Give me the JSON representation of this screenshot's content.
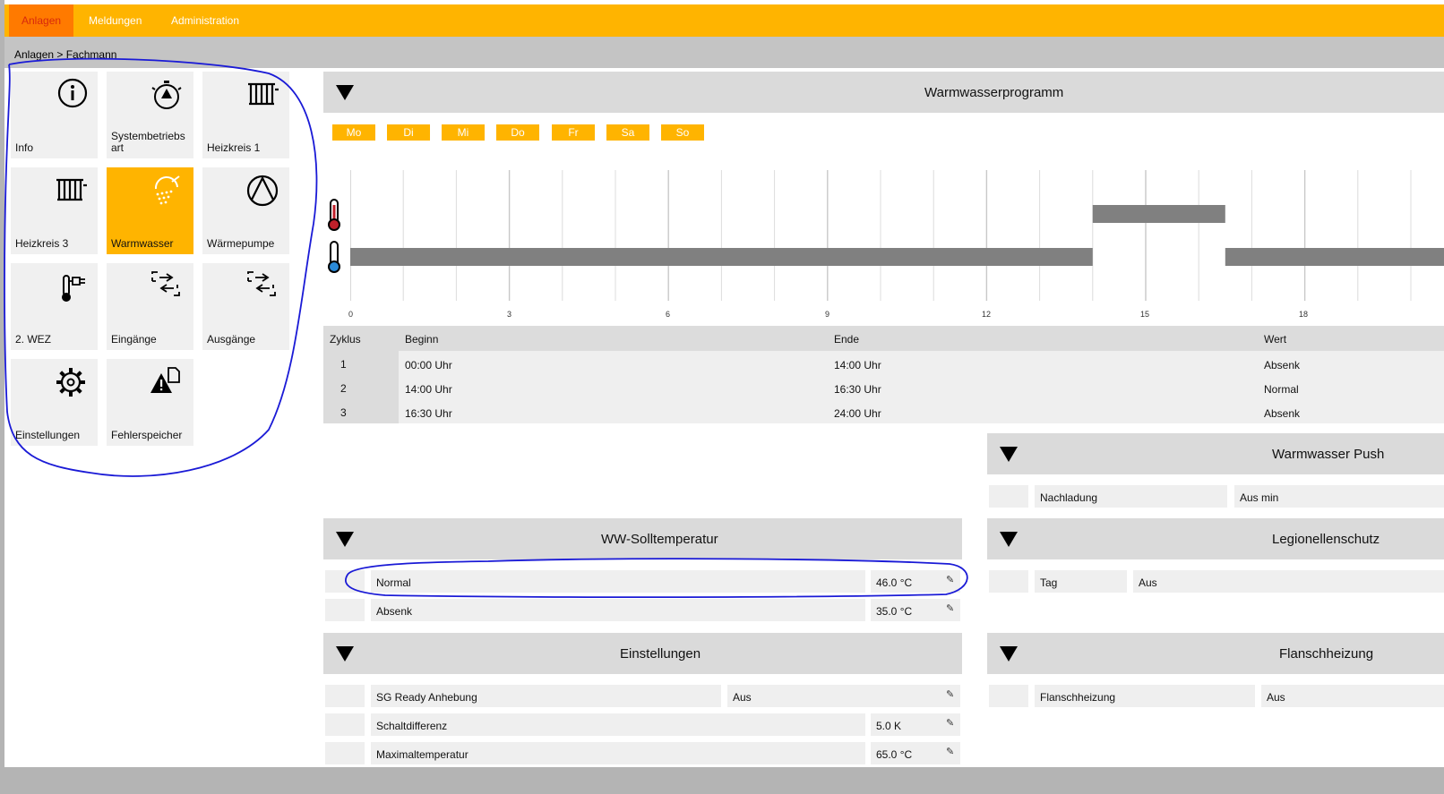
{
  "nav": {
    "tabs": [
      {
        "label": "Anlagen"
      },
      {
        "label": "Meldungen"
      },
      {
        "label": "Administration"
      }
    ]
  },
  "breadcrumb": "Anlagen > Fachmann",
  "tiles": [
    {
      "label": "Info",
      "icon": "info-icon"
    },
    {
      "label": "Systembetriebs art",
      "icon": "timer-icon"
    },
    {
      "label": "Heizkreis 1",
      "icon": "radiator-icon"
    },
    {
      "label": "Heizkreis 3",
      "icon": "radiator-icon"
    },
    {
      "label": "Warmwasser",
      "icon": "shower-icon"
    },
    {
      "label": "Wärmepumpe",
      "icon": "compressor-icon"
    },
    {
      "label": "2. WEZ",
      "icon": "thermometer-plug-icon"
    },
    {
      "label": "Eingänge",
      "icon": "inputs-icon"
    },
    {
      "label": "Ausgänge",
      "icon": "outputs-icon"
    },
    {
      "label": "Einstellungen",
      "icon": "gear-icon"
    },
    {
      "label": "Fehlerspeicher",
      "icon": "warning-file-icon"
    }
  ],
  "program": {
    "title": "Warmwasserprogramm",
    "days": [
      "Mo",
      "Di",
      "Mi",
      "Do",
      "Fr",
      "Sa",
      "So"
    ],
    "ticks": [
      "0",
      "3",
      "6",
      "9",
      "12",
      "15",
      "18"
    ],
    "table": {
      "headers": {
        "zyklus": "Zyklus",
        "beginn": "Beginn",
        "ende": "Ende",
        "wert": "Wert"
      },
      "rows": [
        {
          "zyklus": "1",
          "beginn": "00:00 Uhr",
          "ende": "14:00 Uhr",
          "wert": "Absenk"
        },
        {
          "zyklus": "2",
          "beginn": "14:00 Uhr",
          "ende": "16:30 Uhr",
          "wert": "Normal"
        },
        {
          "zyklus": "3",
          "beginn": "16:30 Uhr",
          "ende": "24:00 Uhr",
          "wert": "Absenk"
        }
      ]
    }
  },
  "chart_data": {
    "type": "bar",
    "x_range": [
      0,
      24
    ],
    "x_ticks": [
      0,
      3,
      6,
      9,
      12,
      15,
      18
    ],
    "levels": [
      "Normal",
      "Absenk"
    ],
    "segments": [
      {
        "start": 0,
        "end": 14,
        "level": "Absenk"
      },
      {
        "start": 14,
        "end": 16.5,
        "level": "Normal"
      },
      {
        "start": 16.5,
        "end": 24,
        "level": "Absenk"
      }
    ],
    "grid": true
  },
  "ww_soll": {
    "title": "WW-Solltemperatur",
    "rows": [
      {
        "label": "Normal",
        "value": "46.0 °C"
      },
      {
        "label": "Absenk",
        "value": "35.0 °C"
      }
    ]
  },
  "einstellungen": {
    "title": "Einstellungen",
    "rows": [
      {
        "label": "SG Ready Anhebung",
        "value": "Aus"
      },
      {
        "label": "Schaltdifferenz",
        "value": "5.0 K"
      },
      {
        "label": "Maximaltemperatur",
        "value": "65.0 °C"
      }
    ]
  },
  "push": {
    "title": "Warmwasser Push",
    "rows": [
      {
        "label": "Nachladung",
        "value": "Aus min"
      }
    ]
  },
  "legionellen": {
    "title": "Legionellenschutz",
    "rows": [
      {
        "label": "Tag",
        "value": "Aus"
      }
    ]
  },
  "flansch": {
    "title": "Flanschheizung",
    "rows": [
      {
        "label": "Flanschheizung",
        "value": "Aus"
      }
    ]
  },
  "colors": {
    "accent": "#ffb400",
    "active_tab": "#ff7a00",
    "bar": "#808080",
    "annotation": "#1a1ad6"
  }
}
